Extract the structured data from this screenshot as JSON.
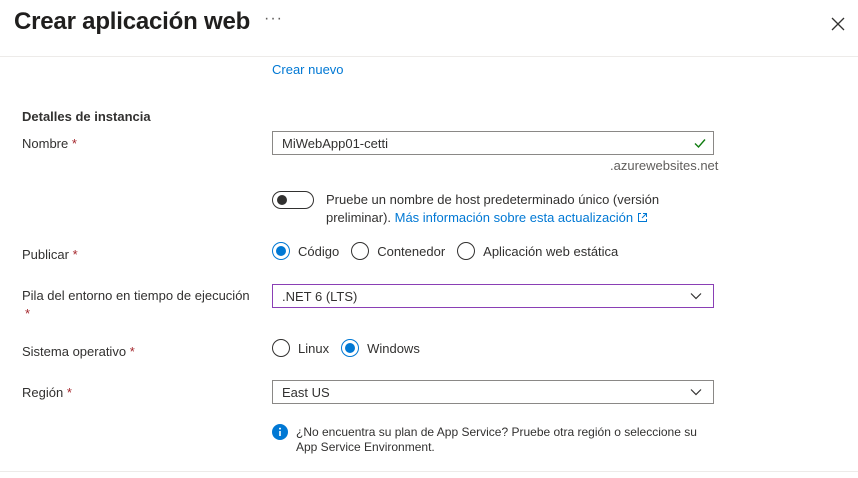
{
  "header": {
    "title": "Crear aplicación web",
    "more": "···"
  },
  "top_link": "Crear nuevo",
  "section_title": "Detalles de instancia",
  "name": {
    "label": "Nombre",
    "required": "*",
    "value": "MiWebApp01-cetti",
    "suffix": ".azurewebsites.net",
    "valid": true
  },
  "hostname_toggle": {
    "on": false,
    "text": "Pruebe un nombre de host predeterminado único (versión preliminar). ",
    "link": "Más información sobre esta actualización"
  },
  "publish": {
    "label": "Publicar",
    "required": "*",
    "options": [
      {
        "label": "Código",
        "selected": true
      },
      {
        "label": "Contenedor",
        "selected": false
      },
      {
        "label": "Aplicación web estática",
        "selected": false
      }
    ]
  },
  "runtime": {
    "label": "Pila del entorno en tiempo de ejecución",
    "required": "*",
    "value": ".NET 6 (LTS)"
  },
  "os": {
    "label": "Sistema operativo",
    "required": "*",
    "options": [
      {
        "label": "Linux",
        "selected": false
      },
      {
        "label": "Windows",
        "selected": true
      }
    ]
  },
  "region": {
    "label": "Región",
    "required": "*",
    "value": "East US"
  },
  "info": {
    "icon": "info-icon",
    "text": "¿No encuentra su plan de App Service? Pruebe otra región o seleccione su App Service Environment."
  },
  "colors": {
    "accent": "#0078d4",
    "focus_border": "#8a3fb5",
    "valid_check": "#107c10",
    "required": "#a4262c"
  }
}
